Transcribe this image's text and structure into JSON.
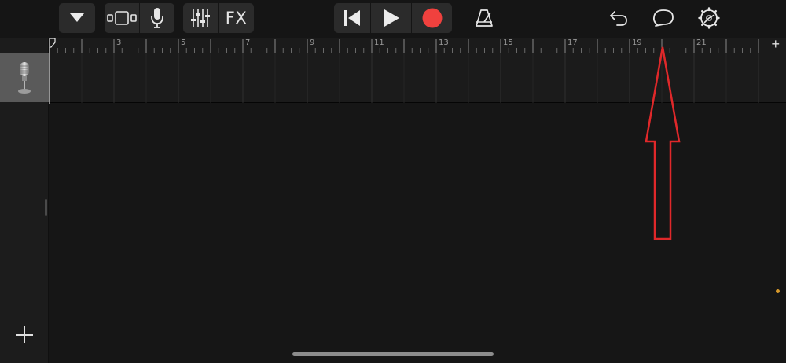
{
  "toolbar": {
    "fx_label": "FX",
    "icons": [
      "dropdown-triangle-icon",
      "tracks-view-icon",
      "microphone-icon",
      "mixer-sliders-icon",
      "skip-to-start-icon",
      "play-icon",
      "record-icon",
      "metronome-icon",
      "undo-icon",
      "loop-icon",
      "settings-gear-icon"
    ],
    "record_color": "#f0413e"
  },
  "ruler": {
    "numbers": [
      "3",
      "5",
      "7",
      "9",
      "11",
      "13",
      "15",
      "17",
      "19",
      "21"
    ],
    "add_label": "+"
  },
  "track_column": {
    "add_track_label": "+",
    "track_icon": "audio-recorder-microphone-icon"
  },
  "annotation": {
    "arrow_color": "#e0282a"
  }
}
